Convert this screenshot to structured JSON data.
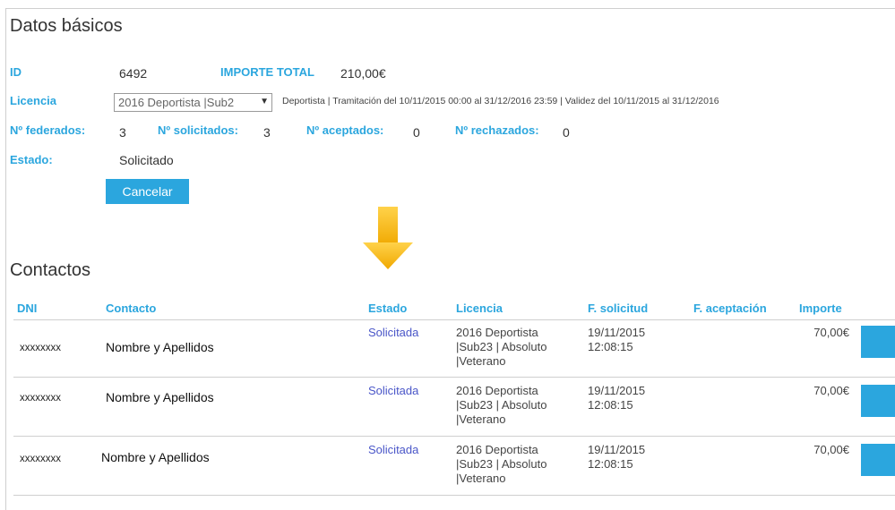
{
  "section_basic": {
    "title": "Datos básicos"
  },
  "basic": {
    "id_label": "ID",
    "id_value": "6492",
    "importe_label": "IMPORTE TOTAL",
    "importe_value": "210,00€",
    "licencia_label": "Licencia",
    "licencia_select": "2016 Deportista |Sub2",
    "licencia_info": "Deportista | Tramitación del 10/11/2015 00:00 al 31/12/2016 23:59 | Validez del 10/11/2015 al 31/12/2016",
    "federados_label": "Nº federados:",
    "federados_value": "3",
    "solicitados_label": "Nº solicitados:",
    "solicitados_value": "3",
    "aceptados_label": "Nº aceptados:",
    "aceptados_value": "0",
    "rechazados_label": "Nº rechazados:",
    "rechazados_value": "0",
    "estado_label": "Estado:",
    "estado_value": "Solicitado",
    "cancel_button": "Cancelar"
  },
  "section_contacts": {
    "title": "Contactos"
  },
  "table": {
    "headers": [
      "DNI",
      "Contacto",
      "Estado",
      "Licencia",
      "F. solicitud",
      "F. aceptación",
      "Importe"
    ],
    "rows": [
      {
        "dni": "xxxxxxxx",
        "contacto": "Nombre y Apellidos",
        "estado": "Solicitada",
        "lic1": "2016 Deportista",
        "lic2": "|Sub23 | Absoluto",
        "lic3": "|Veterano",
        "fecha": "19/11/2015",
        "hora": "12:08:15",
        "importe": "70,00€"
      },
      {
        "dni": "xxxxxxxx",
        "contacto": "Nombre y Apellidos",
        "estado": "Solicitada",
        "lic1": "2016 Deportista",
        "lic2": "|Sub23 | Absoluto",
        "lic3": "|Veterano",
        "fecha": "19/11/2015",
        "hora": "12:08:15",
        "importe": "70,00€"
      },
      {
        "dni": "xxxxxxxx",
        "contacto": "Nombre y Apellidos",
        "estado": "Solicitada",
        "lic1": "2016 Deportista",
        "lic2": "|Sub23 | Absoluto",
        "lic3": "|Veterano",
        "fecha": "19/11/2015",
        "hora": "12:08:15",
        "importe": "70,00€"
      }
    ]
  },
  "colors": {
    "accent": "#2ba6de",
    "arrow": "#f5b400",
    "link": "#4a56c8"
  },
  "icons": {
    "down_arrow": "down-arrow-icon",
    "select_caret": "caret-down-icon"
  }
}
